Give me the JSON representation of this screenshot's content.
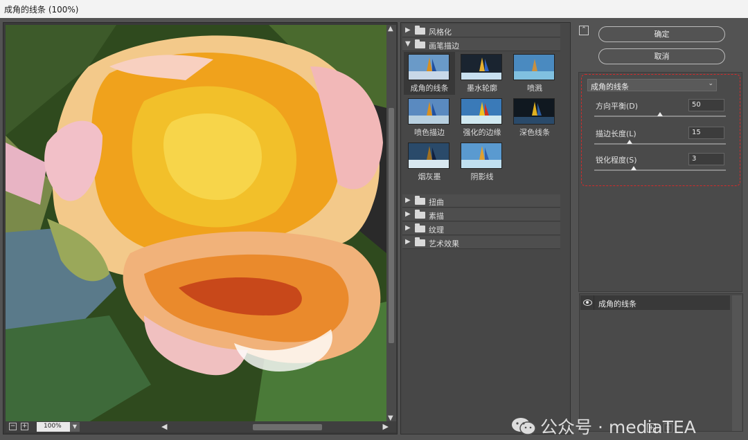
{
  "window": {
    "title": "成角的线条 (100%)"
  },
  "preview": {
    "zoom_value": "100%",
    "zoom_out": "−",
    "zoom_in": "+"
  },
  "gallery": {
    "folders_top": [
      {
        "label": "风格化",
        "expanded": false
      },
      {
        "label": "画笔描边",
        "expanded": true
      }
    ],
    "thumbnails": [
      {
        "label": "成角的线条",
        "selected": true
      },
      {
        "label": "墨水轮廓"
      },
      {
        "label": "喷溅"
      },
      {
        "label": "喷色描边"
      },
      {
        "label": "强化的边缘"
      },
      {
        "label": "深色线条"
      },
      {
        "label": "烟灰墨"
      },
      {
        "label": "阴影线"
      }
    ],
    "folders_bottom": [
      {
        "label": "扭曲"
      },
      {
        "label": "素描"
      },
      {
        "label": "纹理"
      },
      {
        "label": "艺术效果"
      }
    ]
  },
  "buttons": {
    "ok": "确定",
    "cancel": "取消"
  },
  "settings": {
    "filter_select": "成角的线条",
    "params": [
      {
        "label": "方向平衡(D)",
        "value": "50",
        "fraction": 0.5
      },
      {
        "label": "描边长度(L)",
        "value": "15",
        "fraction": 0.27
      },
      {
        "label": "锐化程度(S)",
        "value": "3",
        "fraction": 0.3
      }
    ]
  },
  "layers": {
    "items": [
      {
        "label": "成角的线条"
      }
    ]
  },
  "watermark": "公众号 · mediaTEA",
  "icons": {
    "collapse": "collapse-up-icon",
    "new_layer": "new-layer-icon",
    "delete": "trash-icon",
    "eye": "eye-icon"
  },
  "colors": {
    "highlight_border": "#d62a2a",
    "panel_bg": "#535353"
  }
}
